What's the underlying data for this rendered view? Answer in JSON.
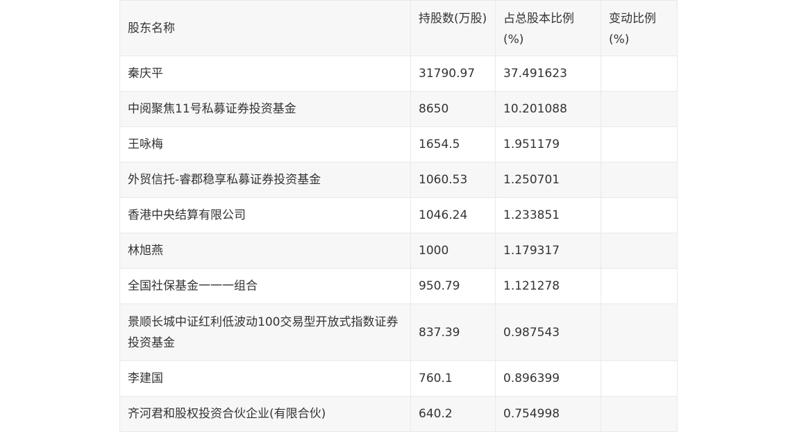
{
  "table": {
    "headers": [
      "股东名称",
      "持股数(万股)",
      "占总股本比例(%)",
      "变动比例(%)"
    ],
    "rows": [
      [
        "秦庆平",
        "31790.97",
        "37.491623",
        ""
      ],
      [
        "中阅聚焦11号私募证券投资基金",
        "8650",
        "10.201088",
        ""
      ],
      [
        "王咏梅",
        "1654.5",
        "1.951179",
        ""
      ],
      [
        "外贸信托-睿郡稳享私募证券投资基金",
        "1060.53",
        "1.250701",
        ""
      ],
      [
        "香港中央结算有限公司",
        "1046.24",
        "1.233851",
        ""
      ],
      [
        "林旭燕",
        "1000",
        "1.179317",
        ""
      ],
      [
        "全国社保基金一一一组合",
        "950.79",
        "1.121278",
        ""
      ],
      [
        "景顺长城中证红利低波动100交易型开放式指数证券投资基金",
        "837.39",
        "0.987543",
        ""
      ],
      [
        "李建国",
        "760.1",
        "0.896399",
        ""
      ],
      [
        "齐河君和股权投资合伙企业(有限合伙)",
        "640.2",
        "0.754998",
        ""
      ]
    ]
  }
}
